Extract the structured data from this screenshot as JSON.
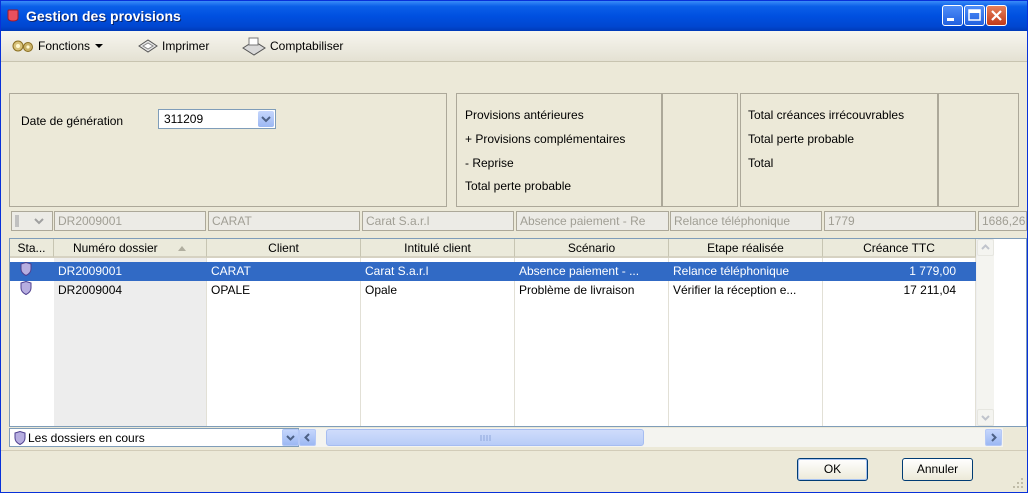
{
  "window": {
    "title": "Gestion des provisions"
  },
  "toolbar": {
    "fonctions": "Fonctions",
    "imprimer": "Imprimer",
    "comptabiliser": "Comptabiliser"
  },
  "generation": {
    "label": "Date de génération",
    "value": "311209"
  },
  "provisions": {
    "line1": "Provisions antérieures",
    "line2": "+ Provisions complémentaires",
    "line3": "- Reprise",
    "line4": "Total perte probable"
  },
  "totals": {
    "line1": "Total créances irrécouvrables",
    "line2": "Total perte probable",
    "line3": "Total"
  },
  "filter_row": {
    "numero": "DR2009001",
    "client": "CARAT",
    "intitule": "Carat S.a.r.l",
    "scenario": "Absence paiement - Re",
    "etape": "Relance téléphonique",
    "creance": "1779",
    "extra": "1686,26"
  },
  "columns": {
    "status": "Sta...",
    "numero": "Numéro dossier",
    "client": "Client",
    "intitule": "Intitulé client",
    "scenario": "Scénario",
    "etape": "Etape réalisée",
    "creance": "Créance TTC"
  },
  "rows": [
    {
      "numero": "DR2009001",
      "client": "CARAT",
      "intitule": "Carat S.a.r.l",
      "scenario": "Absence paiement - ...",
      "etape": "Relance téléphonique",
      "creance": "1 779,00",
      "selected": true
    },
    {
      "numero": "DR2009004",
      "client": "OPALE",
      "intitule": "Opale",
      "scenario": "Problème de livraison",
      "etape": "Vérifier la réception e...",
      "creance": "17 211,04",
      "selected": false
    }
  ],
  "dossier_filter": {
    "value": "Les dossiers en cours"
  },
  "buttons": {
    "ok": "OK",
    "cancel": "Annuler"
  },
  "colors": {
    "titlebar": "#0050e0",
    "selection": "#316ac5",
    "window_bg": "#ece9d8"
  }
}
